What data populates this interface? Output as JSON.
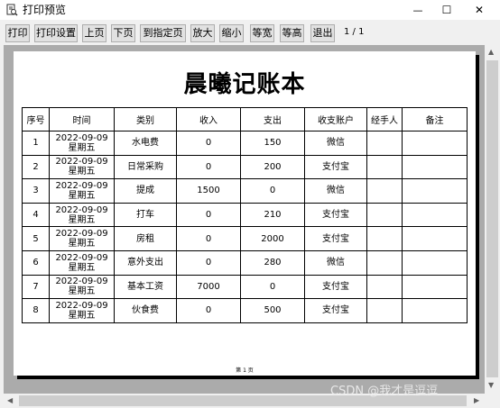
{
  "window": {
    "title": "打印预览",
    "minimize_glyph": "—",
    "maximize_glyph": "☐",
    "close_glyph": "✕"
  },
  "toolbar": {
    "buttons": [
      "打印",
      "打印设置",
      "上页",
      "下页",
      "到指定页",
      "放大",
      "缩小",
      "等宽",
      "等高",
      "退出"
    ],
    "page_indicator": "1 / 1"
  },
  "document": {
    "title": "晨曦记账本",
    "columns": [
      "序号",
      "时间",
      "类别",
      "收入",
      "支出",
      "收支账户",
      "经手人",
      "备注"
    ],
    "rows": [
      {
        "no": "1",
        "date": "2022-09-09",
        "weekday": "星期五",
        "category": "水电费",
        "income": "0",
        "expense": "150",
        "account": "微信",
        "handler": "",
        "note": ""
      },
      {
        "no": "2",
        "date": "2022-09-09",
        "weekday": "星期五",
        "category": "日常采购",
        "income": "0",
        "expense": "200",
        "account": "支付宝",
        "handler": "",
        "note": ""
      },
      {
        "no": "3",
        "date": "2022-09-09",
        "weekday": "星期五",
        "category": "提成",
        "income": "1500",
        "expense": "0",
        "account": "微信",
        "handler": "",
        "note": ""
      },
      {
        "no": "4",
        "date": "2022-09-09",
        "weekday": "星期五",
        "category": "打车",
        "income": "0",
        "expense": "210",
        "account": "支付宝",
        "handler": "",
        "note": ""
      },
      {
        "no": "5",
        "date": "2022-09-09",
        "weekday": "星期五",
        "category": "房租",
        "income": "0",
        "expense": "2000",
        "account": "支付宝",
        "handler": "",
        "note": ""
      },
      {
        "no": "6",
        "date": "2022-09-09",
        "weekday": "星期五",
        "category": "意外支出",
        "income": "0",
        "expense": "280",
        "account": "微信",
        "handler": "",
        "note": ""
      },
      {
        "no": "7",
        "date": "2022-09-09",
        "weekday": "星期五",
        "category": "基本工资",
        "income": "7000",
        "expense": "0",
        "account": "支付宝",
        "handler": "",
        "note": ""
      },
      {
        "no": "8",
        "date": "2022-09-09",
        "weekday": "星期五",
        "category": "伙食费",
        "income": "0",
        "expense": "500",
        "account": "支付宝",
        "handler": "",
        "note": ""
      }
    ],
    "page_footer": "第 1 页"
  },
  "watermark": "CSDN @我才是逗逗"
}
